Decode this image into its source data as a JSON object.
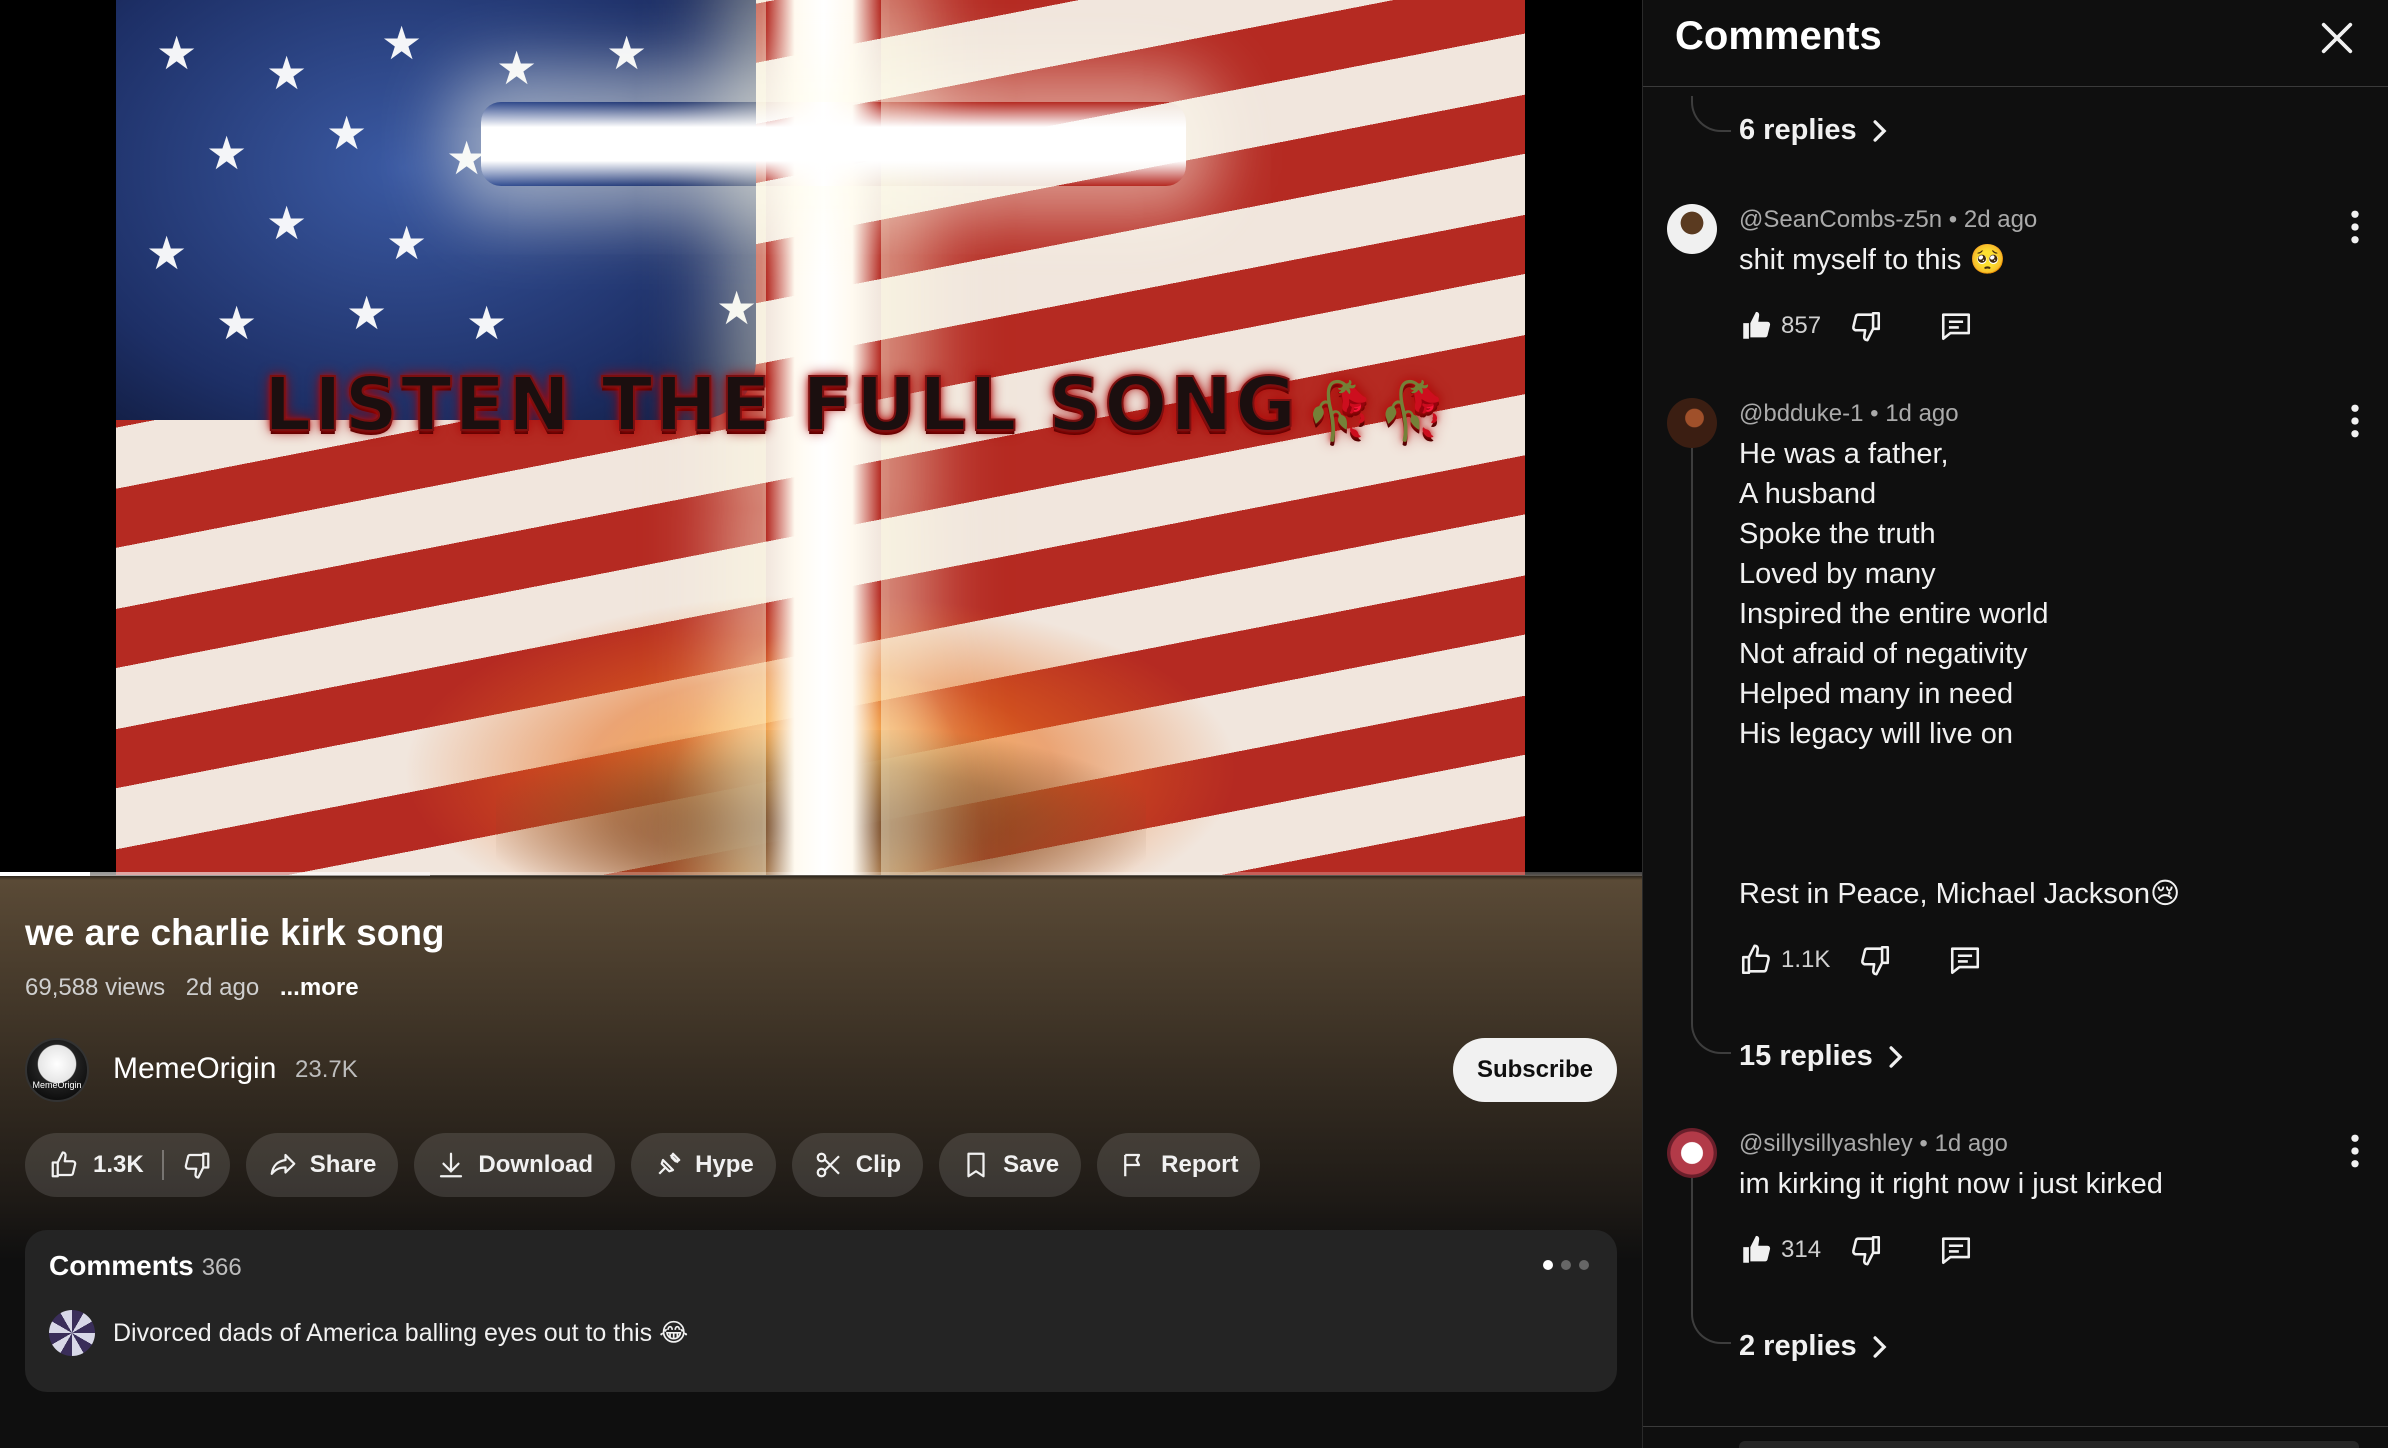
{
  "video": {
    "overlay_text": "LISTEN THE FULL SONG",
    "overlay_decor": "🥀🥀",
    "progress_played": 0.055,
    "progress_buffered": 0.262
  },
  "info": {
    "title": "we are charlie kirk song",
    "views": "69,588 views",
    "age": "2d ago",
    "more": "...more"
  },
  "channel": {
    "name": "MemeOrigin",
    "subscribers": "23.7K",
    "avatar_text": "MemeOrigin",
    "subscribe_label": "Subscribe"
  },
  "actions": {
    "like_count": "1.3K",
    "share": "Share",
    "download": "Download",
    "hype": "Hype",
    "clip": "Clip",
    "save": "Save",
    "report": "Report"
  },
  "comments_preview": {
    "title": "Comments",
    "count": "366",
    "top_comment": "Divorced dads of America balling eyes out to this 😂"
  },
  "panel": {
    "title": "Comments",
    "threads": [
      {
        "replies_label": "6 replies"
      },
      {
        "author": "@SeanCombs-z5n",
        "age": "2d ago",
        "text": "shit myself to this 🥺",
        "likes": "857"
      },
      {
        "author": "@bdduke-1",
        "age": "1d ago",
        "text": "He was a father,\nA husband\nSpoke the truth\nLoved by many\nInspired the entire world\nNot afraid of negativity\nHelped many in need\nHis legacy will live on\n\n\n\nRest in Peace, Michael Jackson😢",
        "likes": "1.1K",
        "replies_label": "15 replies"
      },
      {
        "author": "@sillysillyashley",
        "age": "1d ago",
        "text": "im kirking it right now i just kirked",
        "likes": "314",
        "replies_label": "2 replies"
      }
    ]
  },
  "colors": {
    "background": "#0f0f0f",
    "pill_bg": "#272727",
    "text_primary": "#f1f1f1",
    "text_secondary": "#aaaaaa",
    "subscribe_bg": "#f1f1f1"
  }
}
